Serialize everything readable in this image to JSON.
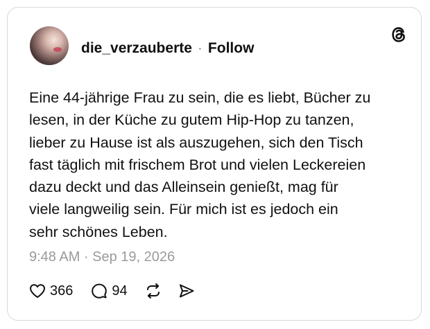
{
  "post": {
    "username": "die_verzauberte",
    "separator": "·",
    "follow_label": "Follow",
    "text": "Eine 44-jährige Frau zu sein, die es liebt, Bücher zu\nlesen, in der Küche zu gutem Hip-Hop zu tanzen,\nlieber zu Hause ist als auszugehen, sich den Tisch\nfast täglich mit frischem Brot und vielen Leckereien\ndazu deckt und das Alleinsein genießt, mag für\nviele langweilig sein. Für mich ist es jedoch ein\nsehr schönes Leben.",
    "timestamp": "9:48 AM · Sep 19, 2026"
  },
  "actions": {
    "likes": "366",
    "replies": "94"
  },
  "icons": {
    "logo": "threads-logo-icon",
    "like": "heart-icon",
    "reply": "speech-bubble-icon",
    "repost": "repost-icon",
    "share": "send-icon"
  },
  "colors": {
    "text": "#101010",
    "muted": "#9a9a9a",
    "border": "#d9d9d9"
  }
}
